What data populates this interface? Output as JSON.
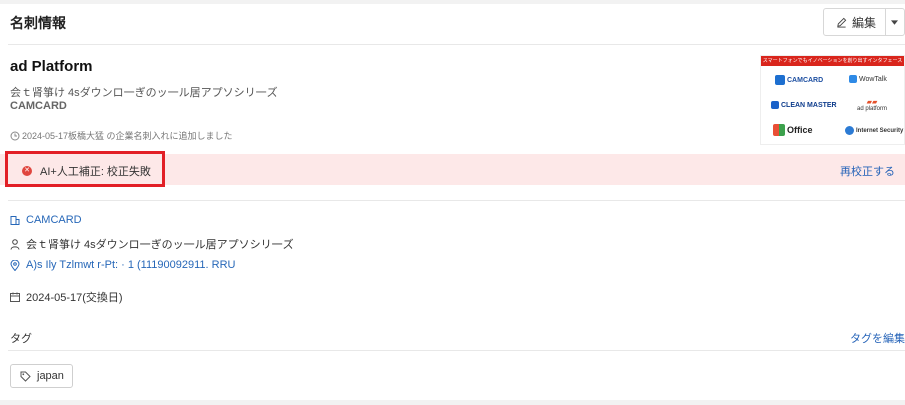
{
  "header": {
    "title": "名刺情報",
    "edit_label": "編集"
  },
  "card": {
    "company": "ad Platform",
    "japanese_name": "会ｔ肾箏け 4sダウンロ一ぎのッ一ル居アプソシリ一ズ",
    "sub_name": "CAMCARD",
    "added_note": "2024-05-17板橋大猛 の企業名刺入れに追加しました"
  },
  "banner": {
    "tagline": "スマートフォンでもイノベーションを創り出すインタフェース",
    "logos": [
      "CAMCARD",
      "WowTalk",
      "CLEAN MASTER",
      "ad platform",
      "Office",
      "Internet Security"
    ]
  },
  "alert": {
    "status": "AI+人工補正: 校正失敗",
    "action": "再校正する",
    "color": "#e21f26"
  },
  "details": {
    "company_link": "CAMCARD",
    "department": "会ｔ肾箏け 4sダウンロ一ぎのッ一ル居アプソシリ一ズ",
    "address": "A)s Ily Tzlmwt r-Pt: · 1 (11190092911. RRU",
    "exchange_date": "2024-05-17(交換日)"
  },
  "tags": {
    "label": "タグ",
    "edit_label": "タグを編集",
    "items": [
      "japan"
    ]
  },
  "colors": {
    "link": "#2667b8",
    "alert_bg": "#fde8e8"
  }
}
